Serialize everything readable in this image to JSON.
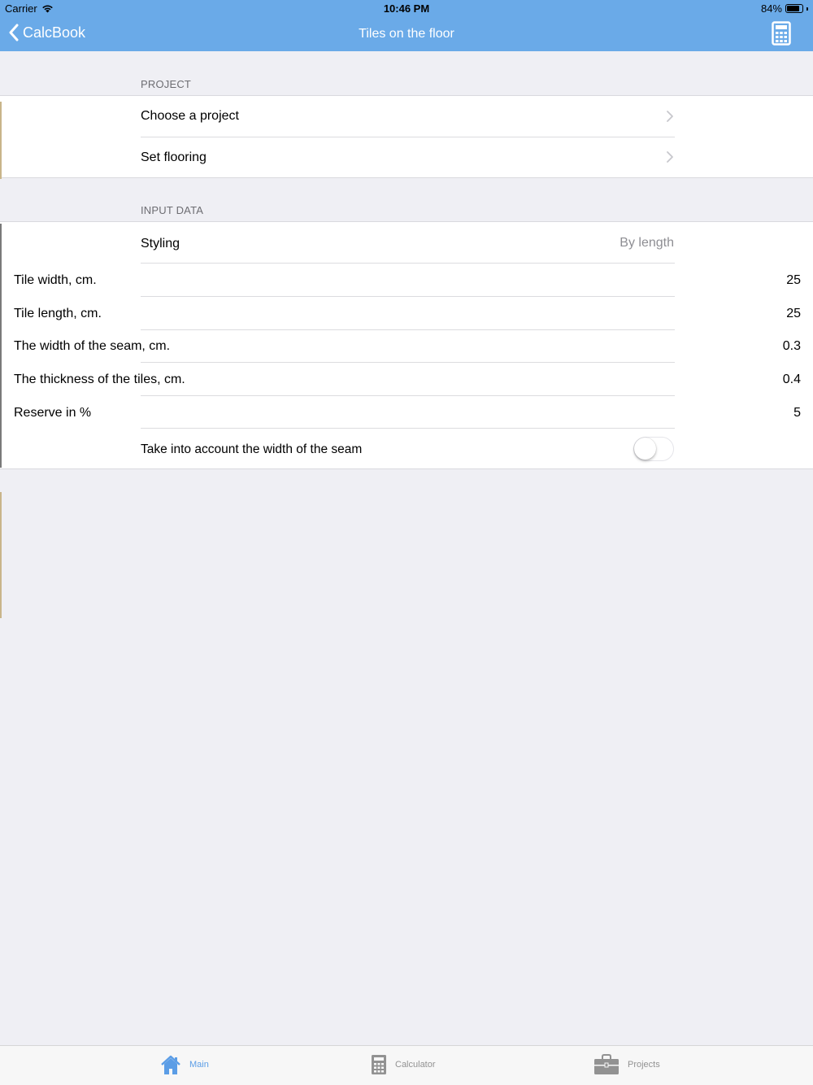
{
  "status_bar": {
    "carrier": "Carrier",
    "time": "10:46 PM",
    "battery": "84%",
    "battery_level": 0.84
  },
  "nav": {
    "back_label": "CalcBook",
    "title": "Tiles on the floor",
    "accent": "#6aaae8"
  },
  "project_section": {
    "header": "PROJECT",
    "rows": [
      {
        "label": "Choose a project"
      },
      {
        "label": "Set flooring"
      }
    ]
  },
  "input_section": {
    "header": "INPUT DATA",
    "styling": {
      "label": "Styling",
      "value": "By length"
    },
    "fields": [
      {
        "label": "Tile width, cm.",
        "value": "25"
      },
      {
        "label": "Tile length, cm.",
        "value": "25"
      },
      {
        "label": "The width of the seam, cm.",
        "value": "0.3"
      },
      {
        "label": "The thickness of the tiles, cm.",
        "value": "0.4"
      },
      {
        "label": "Reserve in %",
        "value": "5"
      }
    ],
    "seam_toggle": {
      "label": "Take into account the width of the seam",
      "on": false
    }
  },
  "tabbar": {
    "tabs": [
      {
        "label": "Main",
        "icon": "home-icon",
        "active": true
      },
      {
        "label": "Calculator",
        "icon": "calculator-icon",
        "active": false
      },
      {
        "label": "Projects",
        "icon": "briefcase-icon",
        "active": false
      }
    ],
    "active_color": "#5b9de6",
    "inactive_color": "#929292"
  }
}
